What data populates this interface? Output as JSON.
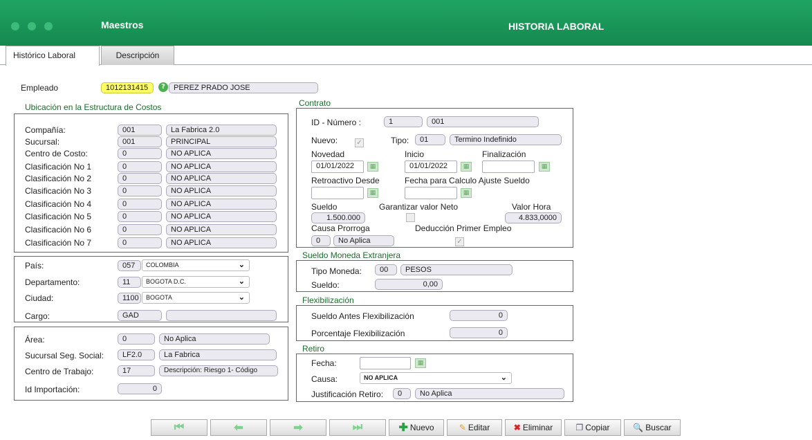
{
  "header": {
    "app_title": "Maestros",
    "screen_title": "HISTORIA LABORAL"
  },
  "tabs": [
    {
      "label": "Histórico Laboral"
    },
    {
      "label": "Descripción"
    }
  ],
  "empleado": {
    "label": "Empleado",
    "id": "1012131415",
    "name": "PEREZ PRADO JOSE"
  },
  "costos": {
    "title": "Ubicación en la Estructura de Costos",
    "rows": [
      {
        "label": "Compañía:",
        "code": "001",
        "desc": "La Fabrica 2.0"
      },
      {
        "label": "Sucursal:",
        "code": "001",
        "desc": "PRINCIPAL"
      },
      {
        "label": "Centro de Costo:",
        "code": "0",
        "desc": "NO APLICA"
      },
      {
        "label": "Clasificación No 1",
        "code": "0",
        "desc": "NO APLICA"
      },
      {
        "label": "Clasificación No 2",
        "code": "0",
        "desc": "NO APLICA"
      },
      {
        "label": "Clasificación No 3",
        "code": "0",
        "desc": "NO APLICA"
      },
      {
        "label": "Clasificación No 4",
        "code": "0",
        "desc": "NO APLICA"
      },
      {
        "label": "Clasificación No 5",
        "code": "0",
        "desc": "NO APLICA"
      },
      {
        "label": "Clasificación No 6",
        "code": "0",
        "desc": "NO APLICA"
      },
      {
        "label": "Clasificación No 7",
        "code": "0",
        "desc": "NO APLICA"
      }
    ]
  },
  "ubicacion": {
    "pais": {
      "label": "País:",
      "code": "057",
      "value": "COLOMBIA"
    },
    "departamento": {
      "label": "Departamento:",
      "code": "11",
      "value": "BOGOTA D.C."
    },
    "ciudad": {
      "label": "Ciudad:",
      "code": "1100",
      "value": "BOGOTA"
    },
    "cargo": {
      "label": "Cargo:",
      "code": "GAD",
      "desc": ""
    }
  },
  "area": {
    "area": {
      "label": "Área:",
      "code": "0",
      "desc": "No Aplica"
    },
    "sucursal_ss": {
      "label": "Sucursal Seg. Social:",
      "code": "LF2.0",
      "desc": "La Fabrica"
    },
    "centro_trabajo": {
      "label": "Centro de Trabajo:",
      "code": "17",
      "desc": "Descripción: Riesgo 1- Código"
    },
    "id_importacion": {
      "label": "Id Importación:",
      "value": "0"
    }
  },
  "contrato": {
    "title": "Contrato",
    "id_label": "ID - Número :",
    "id_value": "1",
    "numero": "001",
    "nuevo_label": "Nuevo:",
    "tipo_label": "Tipo:",
    "tipo_code": "01",
    "tipo_desc": "Termino Indefinido",
    "novedad_label": "Novedad",
    "novedad": "01/01/2022",
    "inicio_label": "Inicio",
    "inicio": "01/01/2022",
    "fin_label": "Finalización",
    "fin": "",
    "retro_label": "Retroactivo Desde",
    "fecha_calc_label": "Fecha para Calculo Ajuste Sueldo",
    "sueldo_label": "Sueldo",
    "sueldo": "1.500.000",
    "garantizar_label": "Garantizar valor Neto",
    "valor_hora_label": "Valor Hora",
    "valor_hora": "4.833,0000",
    "causa_label": "Causa Prorroga",
    "causa_code": "0",
    "causa_desc": "No Aplica",
    "deduccion_label": "Deducción Primer Empleo"
  },
  "moneda": {
    "title": "Sueldo Moneda Extranjera",
    "tipo_label": "Tipo Moneda:",
    "tipo_code": "00",
    "tipo_desc": "PESOS",
    "sueldo_label": "Sueldo:",
    "sueldo": "0,00"
  },
  "flex": {
    "title": "Flexibilización",
    "antes_label": "Sueldo Antes Flexibilización",
    "antes": "0",
    "pct_label": "Porcentaje Flexibilización",
    "pct": "0"
  },
  "retiro": {
    "title": "Retiro",
    "fecha_label": "Fecha:",
    "causa_label": "Causa:",
    "causa_value": "NO APLICA",
    "just_label": "Justificación Retiro:",
    "just_code": "0",
    "just_desc": "No Aplica"
  },
  "toolbar": {
    "nuevo": "Nuevo",
    "editar": "Editar",
    "eliminar": "Eliminar",
    "copiar": "Copiar",
    "buscar": "Buscar"
  }
}
